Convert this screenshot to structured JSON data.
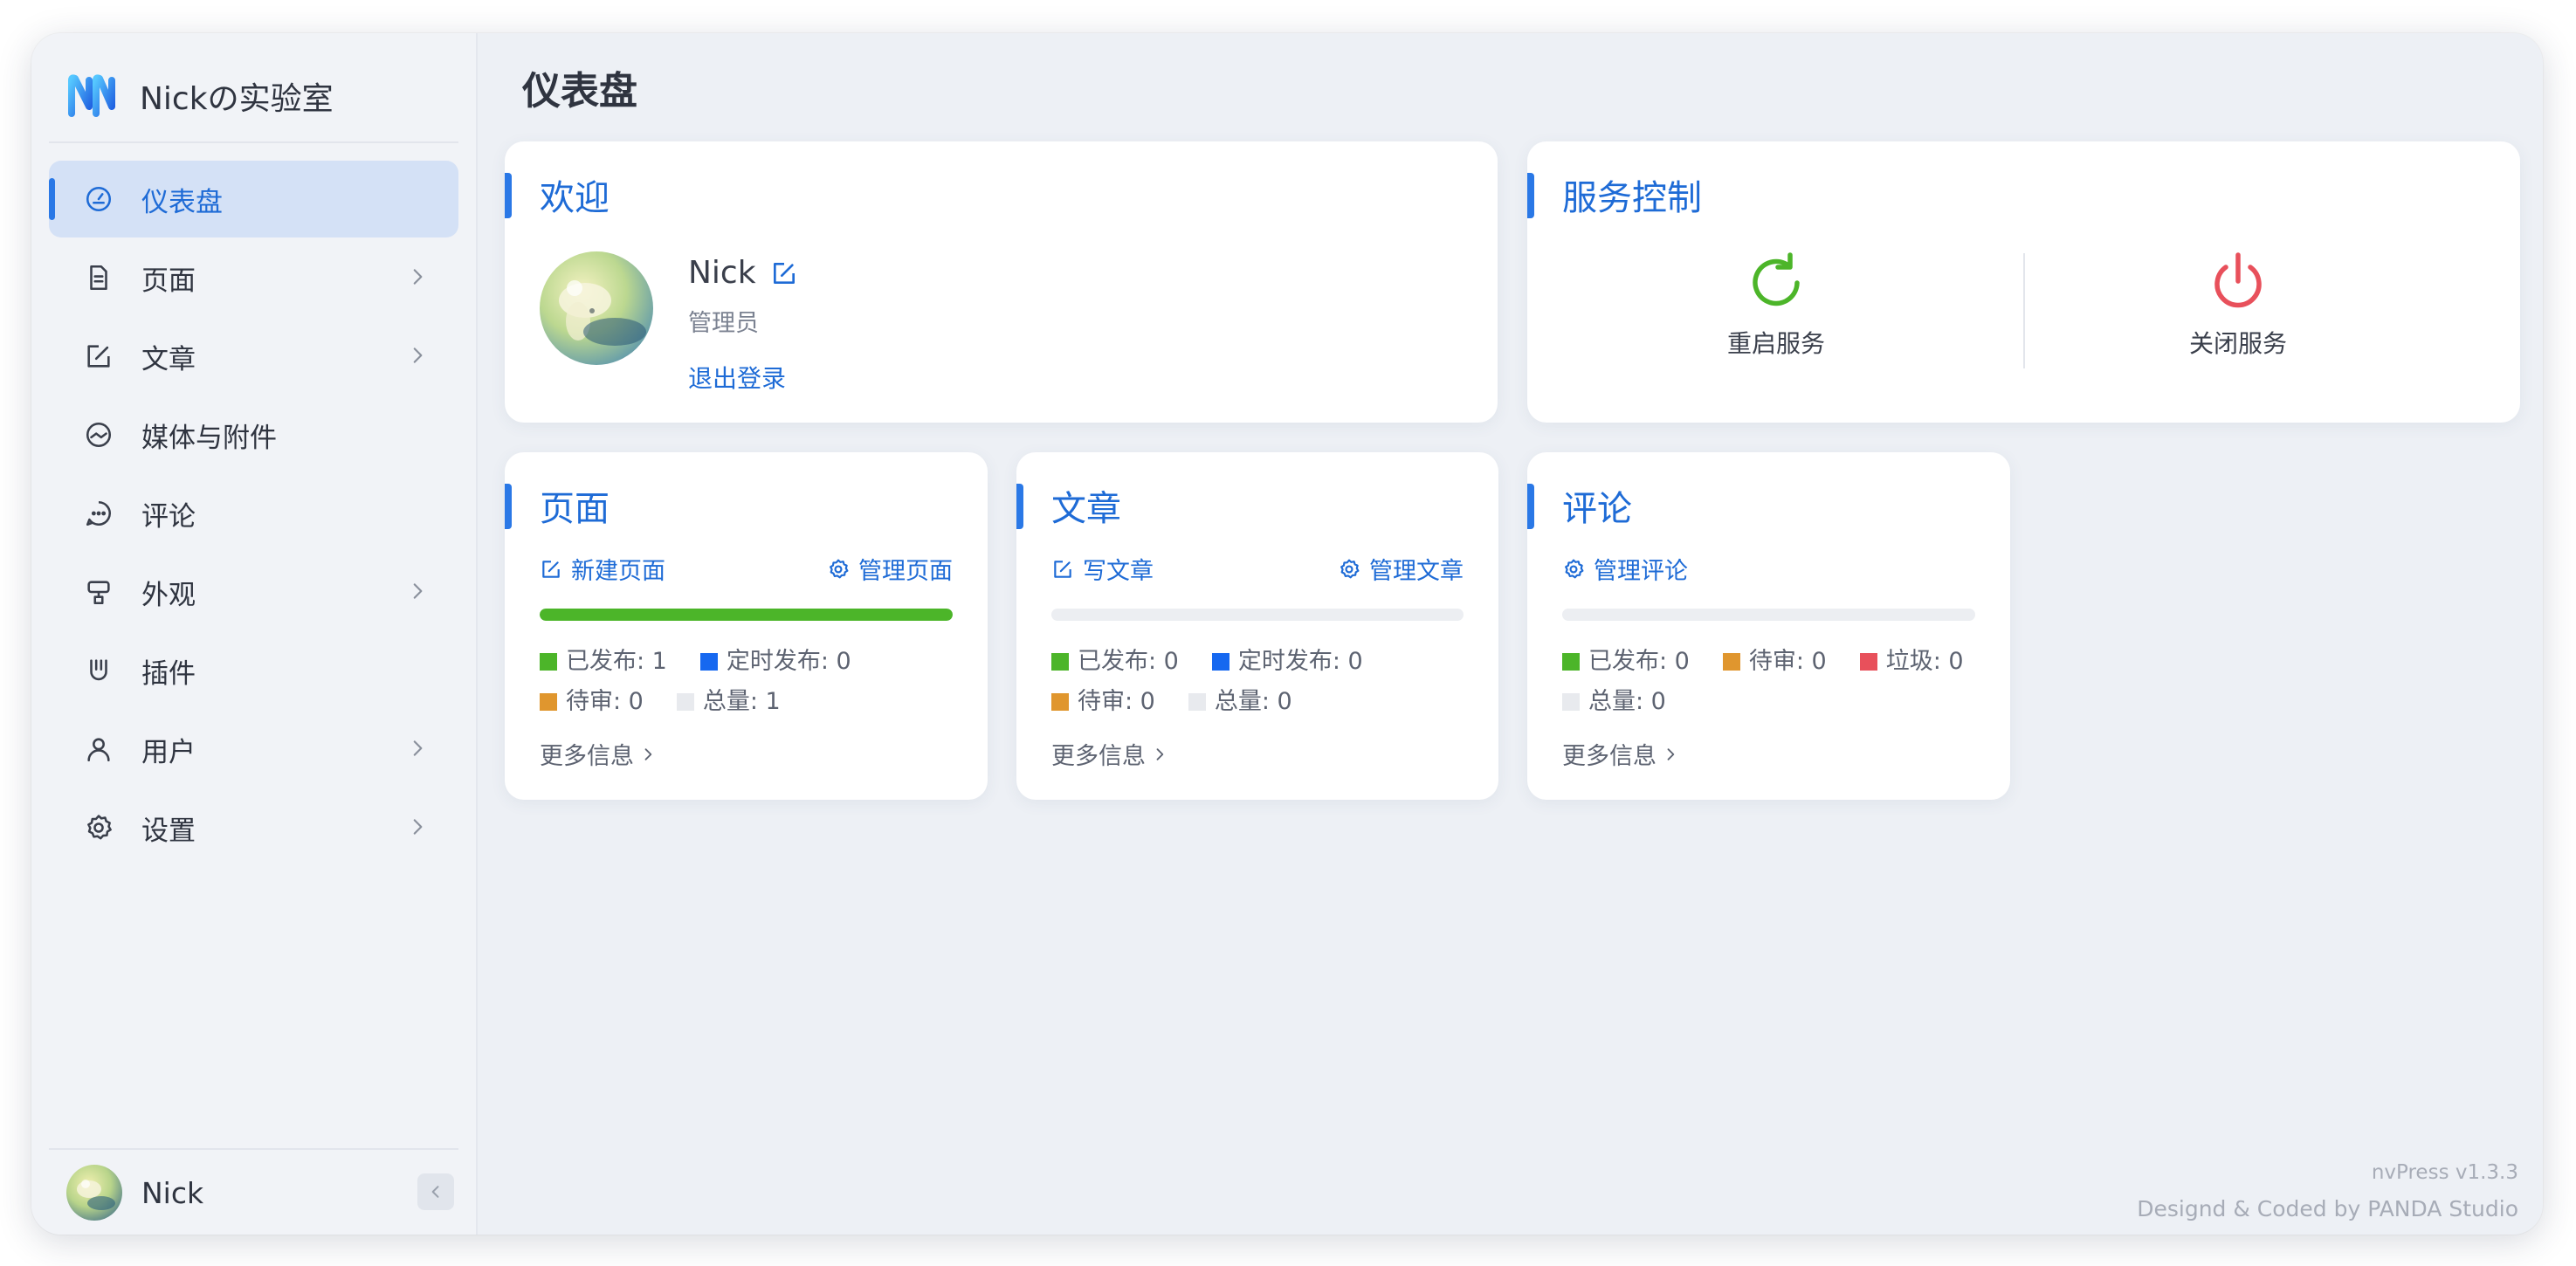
{
  "brand": {
    "name": "Nickの实验室"
  },
  "sidebar": {
    "items": [
      {
        "label": "仪表盘",
        "icon": "dashboard-icon",
        "active": true,
        "has_chevron": false
      },
      {
        "label": "页面",
        "icon": "page-icon",
        "active": false,
        "has_chevron": true
      },
      {
        "label": "文章",
        "icon": "edit-icon",
        "active": false,
        "has_chevron": true
      },
      {
        "label": "媒体与附件",
        "icon": "media-icon",
        "active": false,
        "has_chevron": false
      },
      {
        "label": "评论",
        "icon": "comment-icon",
        "active": false,
        "has_chevron": false
      },
      {
        "label": "外观",
        "icon": "appearance-icon",
        "active": false,
        "has_chevron": true
      },
      {
        "label": "插件",
        "icon": "plugin-icon",
        "active": false,
        "has_chevron": false
      },
      {
        "label": "用户",
        "icon": "user-icon",
        "active": false,
        "has_chevron": true
      },
      {
        "label": "设置",
        "icon": "gear-icon",
        "active": false,
        "has_chevron": true
      }
    ],
    "user": {
      "name": "Nick"
    }
  },
  "main": {
    "title": "仪表盘",
    "welcome": {
      "title": "欢迎",
      "name": "Nick",
      "role": "管理员",
      "logout": "退出登录"
    },
    "service": {
      "title": "服务控制",
      "restart": {
        "label": "重启服务",
        "color": "#4cb529"
      },
      "shutdown": {
        "label": "关闭服务",
        "color": "#e8505b"
      }
    },
    "pages": {
      "title": "页面",
      "action_new": "新建页面",
      "action_manage": "管理页面",
      "progress": 1.0,
      "legend": {
        "published": "已发布: 1",
        "scheduled": "定时发布: 0",
        "pending": "待审: 0",
        "total": "总量: 1"
      },
      "more": "更多信息"
    },
    "articles": {
      "title": "文章",
      "action_new": "写文章",
      "action_manage": "管理文章",
      "progress": 0,
      "legend": {
        "published": "已发布: 0",
        "scheduled": "定时发布: 0",
        "pending": "待审: 0",
        "total": "总量: 0"
      },
      "more": "更多信息"
    },
    "comments": {
      "title": "评论",
      "action_manage": "管理评论",
      "progress": 0,
      "legend": {
        "published": "已发布: 0",
        "pending": "待审: 0",
        "spam": "垃圾: 0",
        "total": "总量: 0"
      },
      "more": "更多信息"
    }
  },
  "footer": {
    "version": "nvPress v1.3.3",
    "credit": "Designd & Coded by PANDA Studio"
  },
  "colors": {
    "accent": "#1e6bd6",
    "published": "#4cb529",
    "scheduled": "#1668f0",
    "pending": "#e0962e",
    "spam": "#e8505b",
    "total": "#e8eaee"
  }
}
